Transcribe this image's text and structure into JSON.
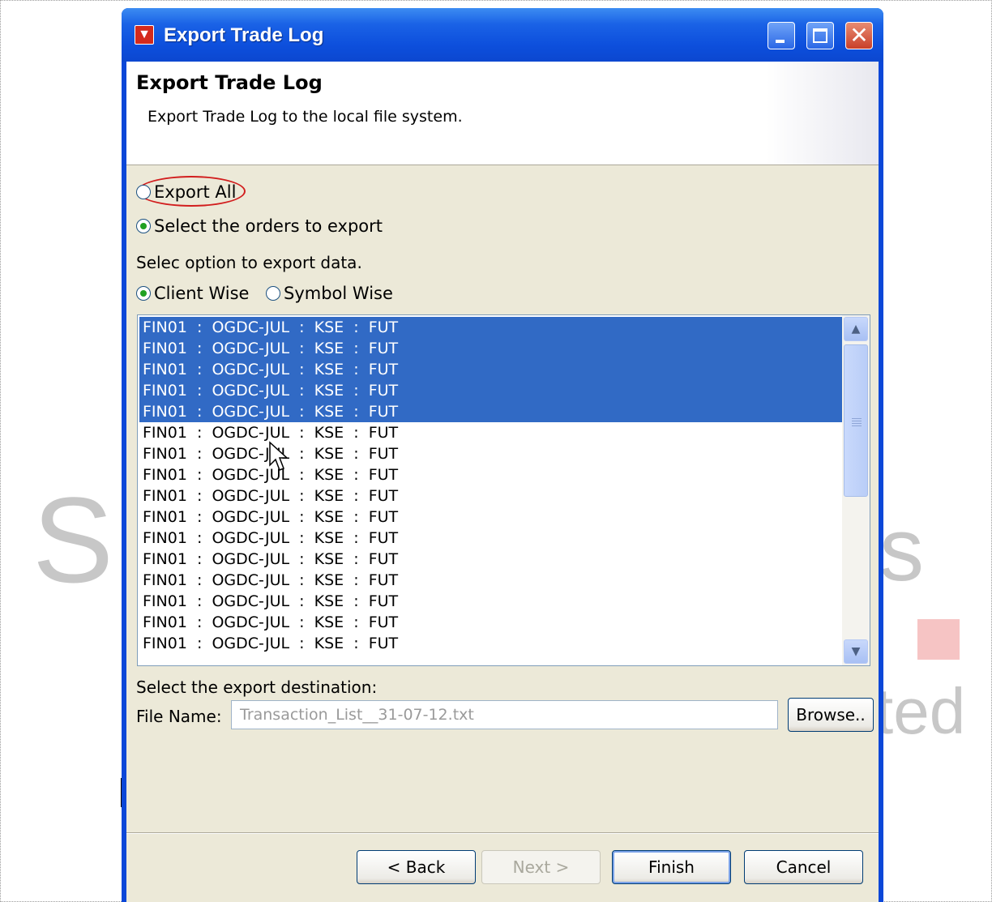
{
  "window": {
    "title": "Export Trade Log",
    "controls": [
      "minimize",
      "maximize",
      "close"
    ]
  },
  "header": {
    "title": "Export Trade Log",
    "description": "Export Trade Log to the local file system."
  },
  "export_mode": {
    "export_all_label": "Export All",
    "select_orders_label": "Select the orders to export",
    "selected": "select_orders"
  },
  "option": {
    "prompt": "Selec option to export data.",
    "client_wise_label": "Client Wise",
    "symbol_wise_label": "Symbol Wise",
    "selected": "client_wise"
  },
  "orders": {
    "rows": [
      {
        "text": "FIN01  :  OGDC-JUL  :  KSE  :  FUT",
        "selected": true
      },
      {
        "text": "FIN01  :  OGDC-JUL  :  KSE  :  FUT",
        "selected": true
      },
      {
        "text": "FIN01  :  OGDC-JUL  :  KSE  :  FUT",
        "selected": true
      },
      {
        "text": "FIN01  :  OGDC-JUL  :  KSE  :  FUT",
        "selected": true
      },
      {
        "text": "FIN01  :  OGDC-JUL  :  KSE  :  FUT",
        "selected": true
      },
      {
        "text": "FIN01  :  OGDC-JUL  :  KSE  :  FUT",
        "selected": false
      },
      {
        "text": "FIN01  :  OGDC-JUL  :  KSE  :  FUT",
        "selected": false
      },
      {
        "text": "FIN01  :  OGDC-JUL  :  KSE  :  FUT",
        "selected": false
      },
      {
        "text": "FIN01  :  OGDC-JUL  :  KSE  :  FUT",
        "selected": false
      },
      {
        "text": "FIN01  :  OGDC-JUL  :  KSE  :  FUT",
        "selected": false
      },
      {
        "text": "FIN01  :  OGDC-JUL  :  KSE  :  FUT",
        "selected": false
      },
      {
        "text": "FIN01  :  OGDC-JUL  :  KSE  :  FUT",
        "selected": false
      },
      {
        "text": "FIN01  :  OGDC-JUL  :  KSE  :  FUT",
        "selected": false
      },
      {
        "text": "FIN01  :  OGDC-JUL  :  KSE  :  FUT",
        "selected": false
      },
      {
        "text": "FIN01  :  OGDC-JUL  :  KSE  :  FUT",
        "selected": false
      },
      {
        "text": "FIN01  :  OGDC-JUL  :  KSE  :  FUT",
        "selected": false
      }
    ]
  },
  "destination": {
    "prompt": "Select the export destination:",
    "file_name_label": "File Name:",
    "file_name_value": "Transaction_List__31-07-12.txt",
    "browse_label": "Browse.."
  },
  "footer": {
    "back_label": "< Back",
    "next_label": "Next >",
    "finish_label": "Finish",
    "cancel_label": "Cancel"
  },
  "colors": {
    "titlebar": "#0d4fdc",
    "selection": "#316ac5",
    "dialog_bg": "#ece9d8",
    "annotation": "#d21e1e"
  }
}
